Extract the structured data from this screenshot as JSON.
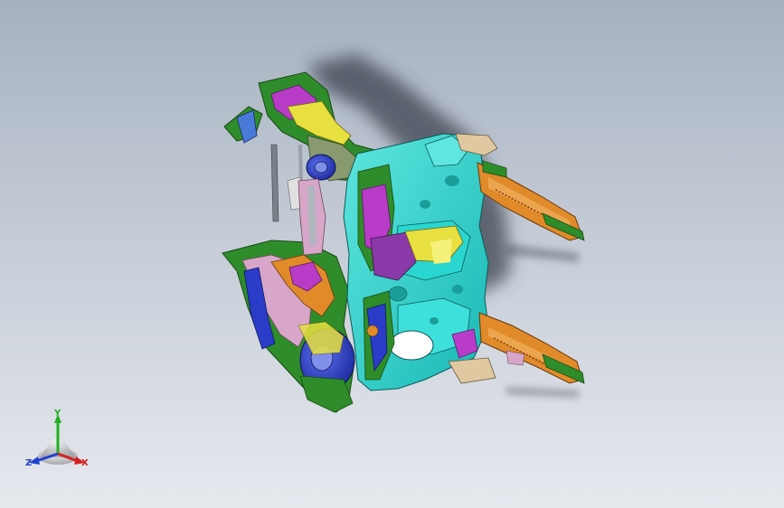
{
  "viewport": {
    "background_top": "#a6b1c0",
    "background_bottom": "#e6e9ee",
    "model_colors": {
      "cyan": "#29d6d0",
      "green": "#2f8c2a",
      "magenta": "#b83cc8",
      "orange": "#e08a2a",
      "yellow": "#e8e040",
      "blue": "#2a3cc8",
      "pink": "#d8a6c8",
      "shadow": "#4a4f5c"
    }
  },
  "triad": {
    "x_label": "X",
    "y_label": "Y",
    "z_label": "Z",
    "x_color": "#d42020",
    "y_color": "#20b020",
    "z_color": "#2040d0"
  }
}
